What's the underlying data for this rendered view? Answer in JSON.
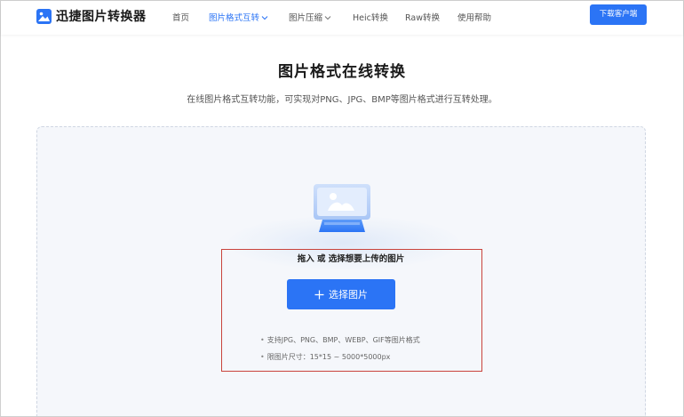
{
  "header": {
    "logo_text": "迅捷图片转换器",
    "nav": [
      {
        "label": "首页",
        "active": false
      },
      {
        "label": "图片格式互转",
        "active": true
      },
      {
        "label": "图片压缩",
        "active": false
      },
      {
        "label": "Heic转换",
        "active": false
      },
      {
        "label": "Raw转换",
        "active": false
      },
      {
        "label": "使用帮助",
        "active": false
      }
    ],
    "download_label": "下载客户端"
  },
  "main": {
    "title": "图片格式在线转换",
    "subtitle": "在线图片格式互转功能，可实现对PNG、JPG、BMP等图片格式进行互转处理。"
  },
  "upload": {
    "hint": "拖入 或 选择想要上传的图片",
    "button_label": "选择图片",
    "info": [
      "支持JPG、PNG、BMP、WEBP、GIF等图片格式",
      "限图片尺寸：15*15 ~ 5000*5000px"
    ]
  },
  "colors": {
    "accent": "#2b74f5",
    "highlight_border": "#c9433c",
    "upload_bg": "#f5f7fb"
  }
}
